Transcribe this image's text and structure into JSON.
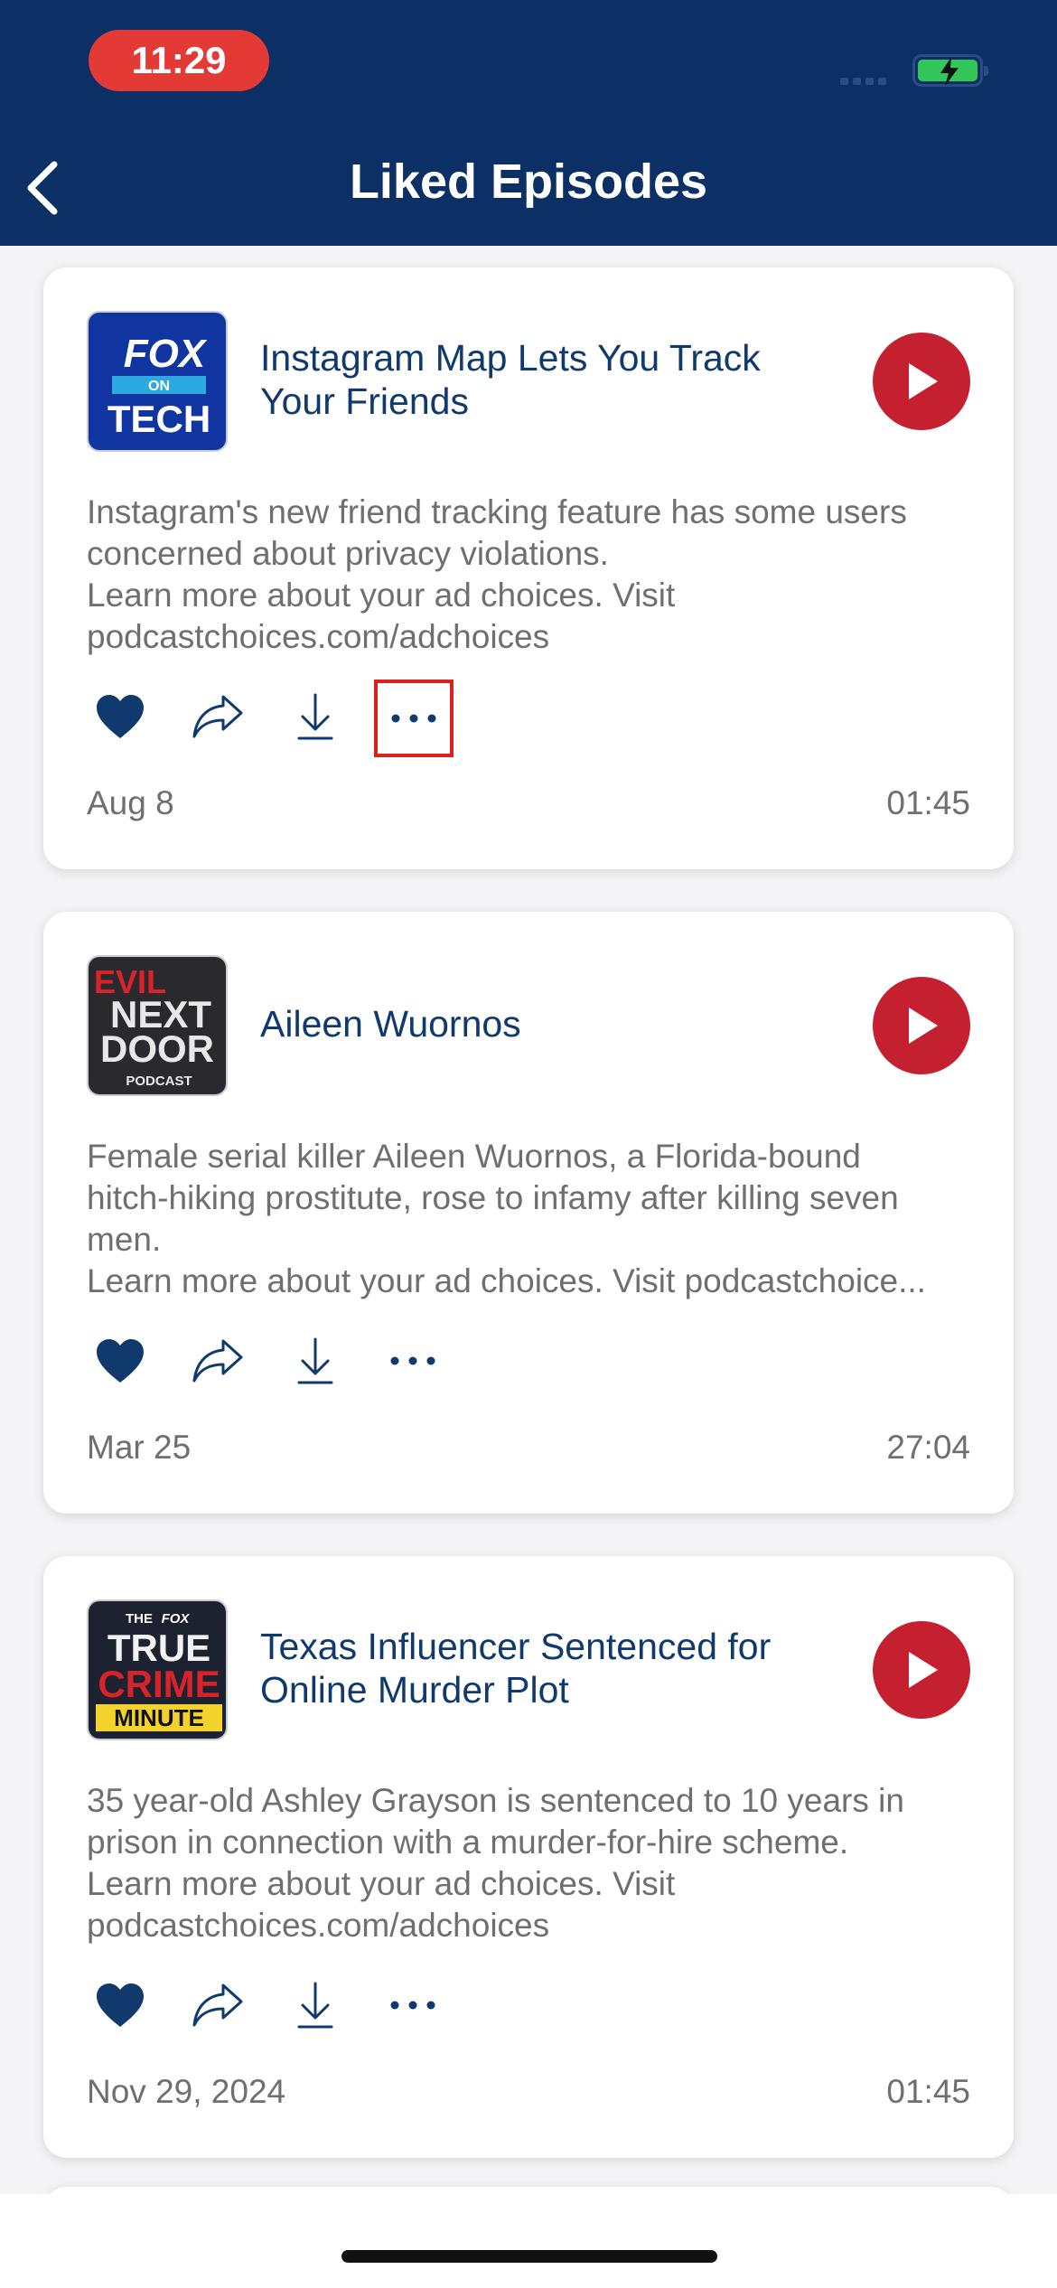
{
  "status_bar": {
    "time": "11:29"
  },
  "header": {
    "title": "Liked Episodes"
  },
  "episodes": [
    {
      "podcast": "Fox on Tech",
      "art_lines": [
        "FOX",
        "ON",
        "TECH"
      ],
      "title": "Instagram Map Lets You Track Your Friends",
      "description": [
        "Instagram's new friend tracking feature has some users",
        "concerned about privacy violations.",
        "Learn more about your ad choices. Visit",
        "podcastchoices.com/adchoices"
      ],
      "date": "Aug 8",
      "duration": "01:45"
    },
    {
      "podcast": "Evil Next Door",
      "art_lines": [
        "EVIL",
        "NEXT",
        "DOOR",
        "PODCAST"
      ],
      "title": "Aileen Wuornos",
      "description": [
        "Female serial killer Aileen Wuornos, a Florida-bound",
        "hitch-hiking prostitute, rose to infamy after killing seven",
        "men.",
        "Learn more about your ad choices. Visit podcastchoice..."
      ],
      "date": "Mar 25",
      "duration": "27:04"
    },
    {
      "podcast": "The Fox True Crime Minute",
      "art_lines": [
        "THE",
        "FOX",
        "TRUE",
        "CRIME",
        "MINUTE"
      ],
      "title": "Texas Influencer Sentenced for Online Murder Plot",
      "description": [
        "35 year-old Ashley Grayson is sentenced to 10 years in",
        "prison in connection with a murder-for-hire scheme.",
        "Learn more about your ad choices. Visit",
        "podcastchoices.com/adchoices"
      ],
      "date": "Nov 29, 2024",
      "duration": "01:45"
    }
  ],
  "icons": {
    "back": "chevron-left-icon",
    "play": "play-icon",
    "like": "heart-icon",
    "share": "share-icon",
    "download": "download-icon",
    "more": "more-icon"
  },
  "colors": {
    "header_bg": "#0c3066",
    "accent_red": "#c5202f",
    "title_blue": "#103a6e",
    "time_pill": "#e43a35",
    "highlight_box": "#d9211f"
  }
}
